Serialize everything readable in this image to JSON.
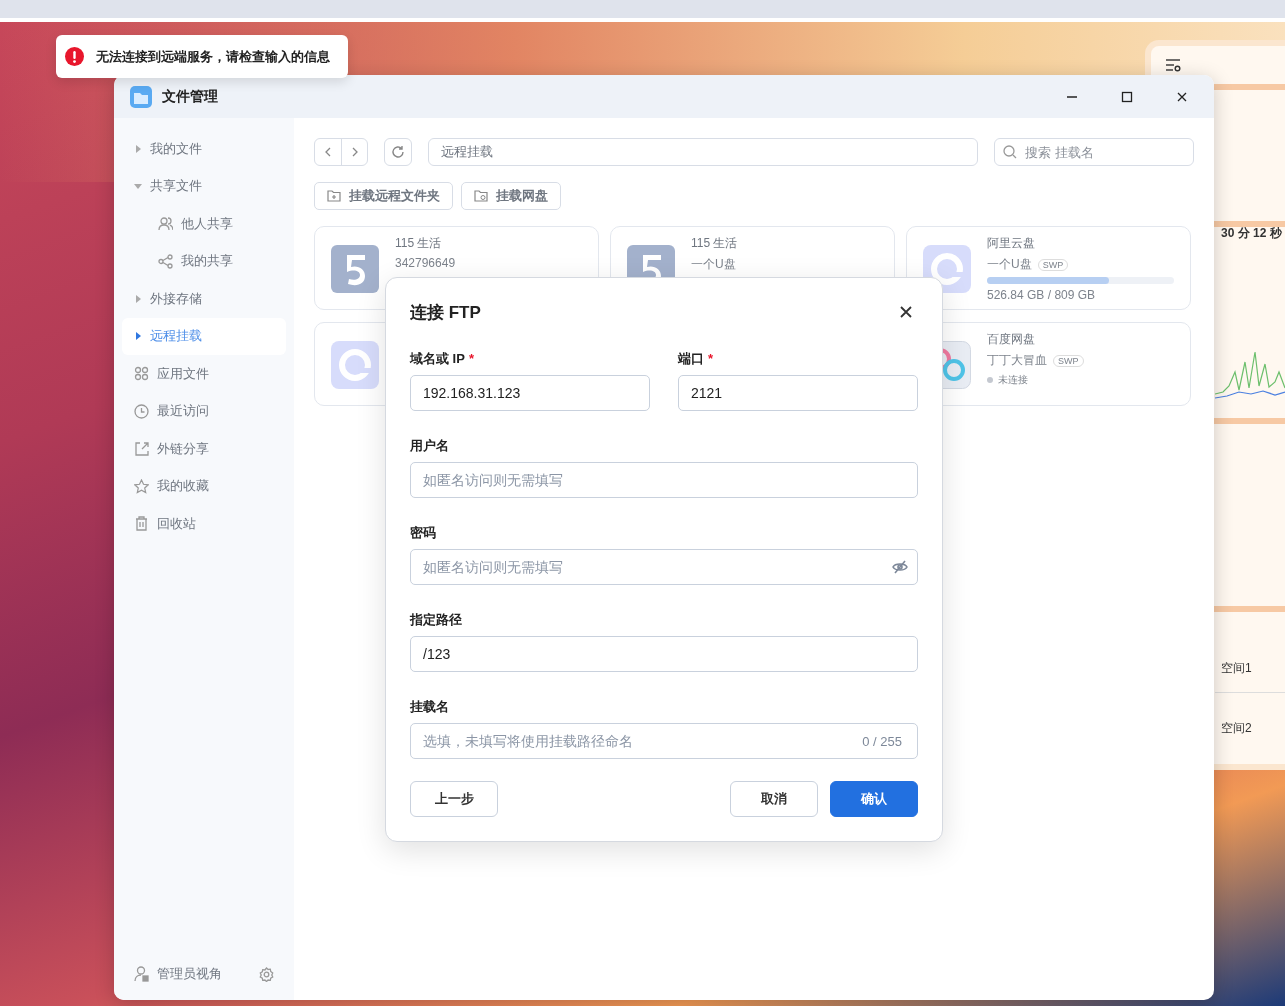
{
  "toast": {
    "kind": "error",
    "text": "无法连接到远端服务，请检查输入的信息"
  },
  "widget": {
    "elapsed": "30 分 12 秒",
    "spaces": [
      "空间1",
      "空间2"
    ]
  },
  "window": {
    "title": "文件管理"
  },
  "sidebar": {
    "items": [
      {
        "kind": "group",
        "label": "我的文件",
        "expanded": false,
        "selected": false
      },
      {
        "kind": "group",
        "label": "共享文件",
        "expanded": true,
        "selected": false,
        "children": [
          {
            "label": "他人共享",
            "selected": false
          },
          {
            "label": "我的共享",
            "selected": false
          }
        ]
      },
      {
        "kind": "group",
        "label": "外接存储",
        "expanded": false,
        "selected": false
      },
      {
        "kind": "group",
        "label": "远程挂载",
        "expanded": false,
        "selected": true
      },
      {
        "kind": "link",
        "label": "应用文件",
        "selected": false
      },
      {
        "kind": "link",
        "label": "最近访问",
        "selected": false
      },
      {
        "kind": "link",
        "label": "外链分享",
        "selected": false
      },
      {
        "kind": "link",
        "label": "我的收藏",
        "selected": false
      },
      {
        "kind": "link",
        "label": "回收站",
        "selected": false
      }
    ],
    "footer": "管理员视角"
  },
  "toolbar": {
    "path": "远程挂载",
    "search_placeholder": "搜索 挂载名",
    "buttons": [
      "挂载远程文件夹",
      "挂载网盘"
    ]
  },
  "cards": [
    {
      "kind": "numeral",
      "name": "115 生活",
      "account": "342796649"
    },
    {
      "kind": "numeral",
      "name": "115 生活",
      "account": "一个U盘"
    },
    {
      "kind": "ring",
      "name": "阿里云盘",
      "account": "一个U盘",
      "badge": "SWP",
      "level": 0.65,
      "usage": "526.84 GB / 809 GB"
    },
    {
      "kind": "ring"
    },
    {
      "kind": "petals",
      "name": "百度网盘",
      "account": "丁丁大冒血",
      "badge": "SWP",
      "status": {
        "text": "未连接",
        "connected": false
      }
    }
  ],
  "dialog": {
    "title": "连接 FTP",
    "fields": [
      {
        "kind": "text",
        "label": "域名或 IP",
        "required_mark": "*",
        "value": "192.168.31.123"
      },
      {
        "kind": "text",
        "label": "端口",
        "required_mark": "*",
        "value": "2121"
      },
      {
        "kind": "text",
        "label": "用户名",
        "placeholder": "如匿名访问则无需填写"
      },
      {
        "kind": "password",
        "label": "密码",
        "placeholder": "如匿名访问则无需填写"
      },
      {
        "kind": "text",
        "label": "指定路径",
        "value": "/123"
      },
      {
        "kind": "text",
        "label": "挂载名",
        "placeholder": "选填，未填写将使用挂载路径命名",
        "counter": "0 / 255"
      }
    ],
    "buttons": [
      {
        "kind": "secondary",
        "label": "上一步"
      },
      {
        "kind": "secondary",
        "label": "取消"
      },
      {
        "kind": "primary",
        "label": "确认"
      }
    ]
  }
}
